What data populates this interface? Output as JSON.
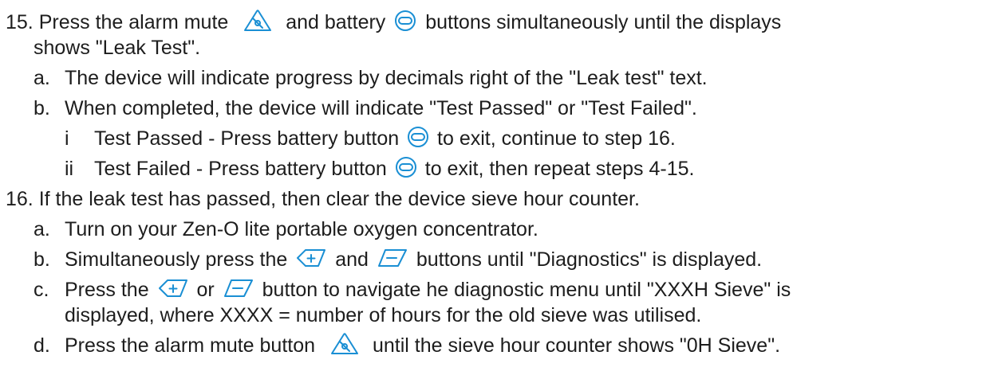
{
  "colors": {
    "text": "#1d1d1d",
    "icon_accent": "#1a8fd4"
  },
  "icons": {
    "alarm_mute": "alarm-mute-triangle-icon",
    "battery": "battery-button-icon",
    "plus": "plus-button-icon",
    "minus": "minus-button-icon"
  },
  "steps": {
    "s15": {
      "num": "15.",
      "t1": "Press the alarm mute",
      "t2": "and battery",
      "t3": "buttons simultaneously until the displays",
      "t4": "shows \"Leak Test\".",
      "a": {
        "label": "a.",
        "text": "The device will indicate progress by decimals right of the \"Leak test\" text."
      },
      "b": {
        "label": "b.",
        "text": "When completed, the device will indicate \"Test Passed\" or \"Test Failed\"."
      },
      "i": {
        "label": "i",
        "t1": "Test Passed - Press battery button",
        "t2": "to exit, continue to step 16."
      },
      "ii": {
        "label": "ii",
        "t1": "Test Failed - Press battery button",
        "t2": "to exit, then repeat steps 4-15."
      }
    },
    "s16": {
      "num": "16.",
      "text": "If the leak test has passed, then clear the device sieve hour counter.",
      "a": {
        "label": "a.",
        "text": "Turn on your Zen-O lite portable oxygen concentrator."
      },
      "b": {
        "label": "b.",
        "t1": "Simultaneously press the",
        "t2": "and",
        "t3": "buttons until \"Diagnostics\" is displayed."
      },
      "c": {
        "label": "c.",
        "t1": "Press the",
        "t2": "or",
        "t3": "button to navigate he diagnostic menu until \"XXXH Sieve\" is",
        "t4": "displayed, where XXXX = number of hours for the old sieve was utilised."
      },
      "d": {
        "label": "d.",
        "t1": "Press the alarm mute button",
        "t2": "until the sieve hour counter shows \"0H Sieve\"."
      }
    }
  }
}
